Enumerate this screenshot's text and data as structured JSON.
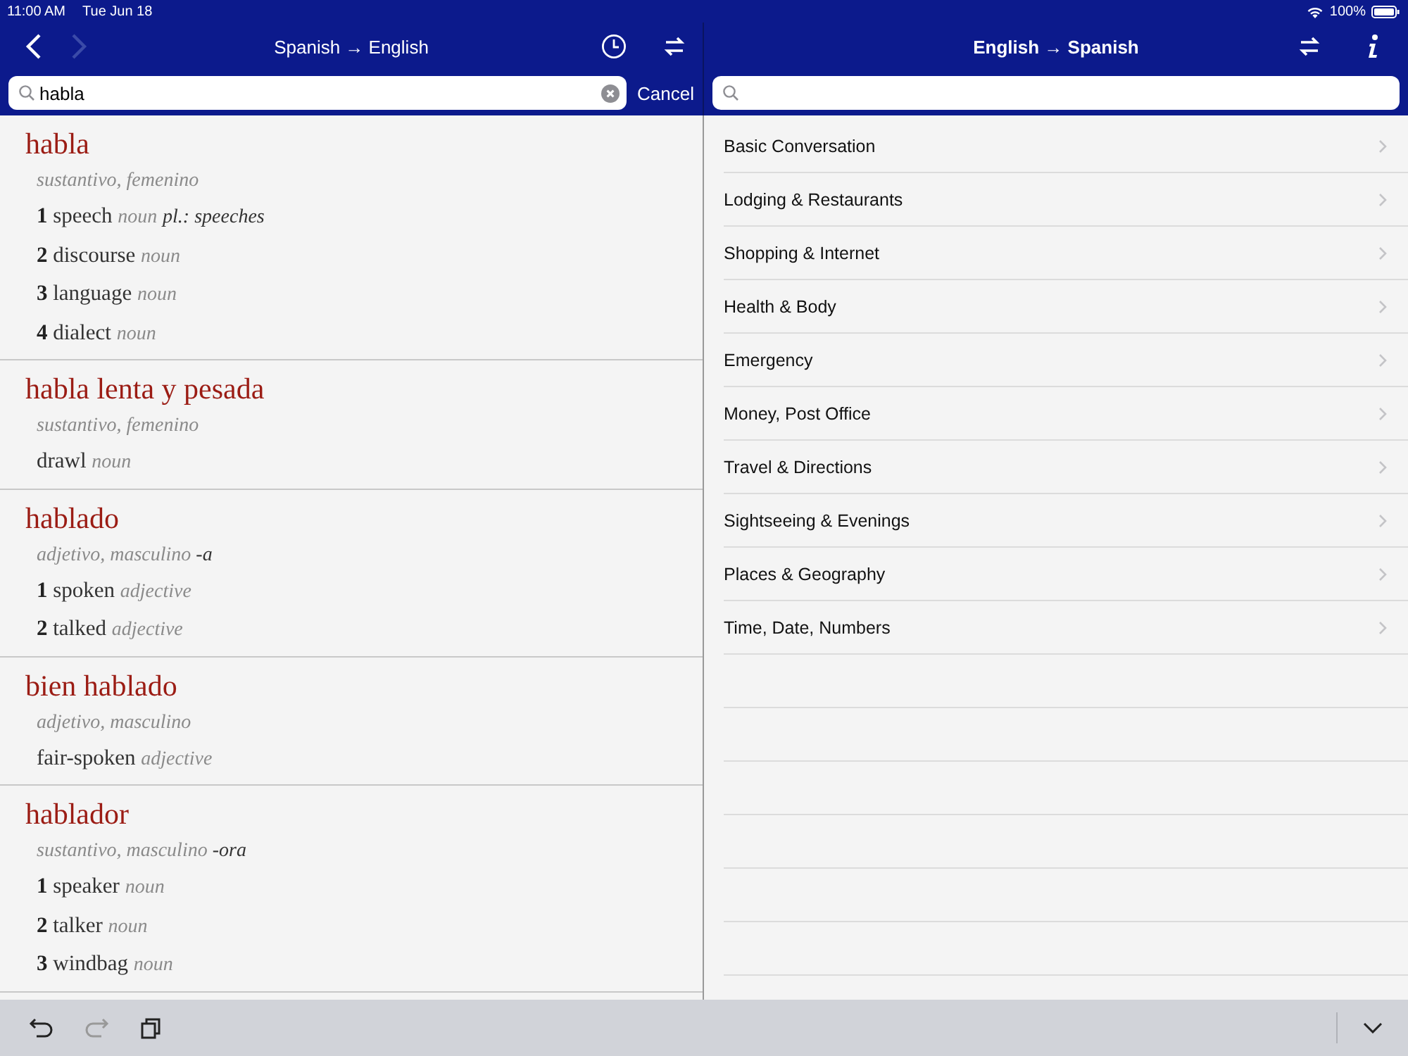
{
  "status_bar": {
    "time": "11:00 AM",
    "date": "Tue Jun 18",
    "battery": "100%"
  },
  "left_pane": {
    "nav": {
      "back": {
        "disabled": false
      },
      "forward": {
        "disabled": true
      }
    },
    "title": "Spanish → English",
    "search": {
      "value": "habla"
    },
    "cancel": "Cancel",
    "entries": [
      {
        "headword": "habla",
        "grammar": "sustantivo, femenino",
        "senses": [
          {
            "number": "1",
            "word": "speech",
            "pos": "noun",
            "extra": "pl.: speeches"
          },
          {
            "number": "2",
            "word": "discourse",
            "pos": "noun"
          },
          {
            "number": "3",
            "word": "language",
            "pos": "noun"
          },
          {
            "number": "4",
            "word": "dialect",
            "pos": "noun"
          }
        ]
      },
      {
        "headword": "habla lenta y pesada",
        "grammar": "sustantivo, femenino",
        "senses": [
          {
            "word": "drawl",
            "pos": "noun"
          }
        ]
      },
      {
        "headword": "hablado",
        "grammar": "adjetivo, masculino",
        "suffix": "-a",
        "senses": [
          {
            "number": "1",
            "word": "spoken",
            "pos": "adjective"
          },
          {
            "number": "2",
            "word": "talked",
            "pos": "adjective"
          }
        ]
      },
      {
        "headword": "bien hablado",
        "grammar": "adjetivo, masculino",
        "senses": [
          {
            "word": "fair-spoken",
            "pos": "adjective"
          }
        ]
      },
      {
        "headword": "hablador",
        "grammar": "sustantivo, masculino",
        "suffix": "-ora",
        "senses": [
          {
            "number": "1",
            "word": "speaker",
            "pos": "noun"
          },
          {
            "number": "2",
            "word": "talker",
            "pos": "noun"
          },
          {
            "number": "3",
            "word": "windbag",
            "pos": "noun"
          }
        ]
      }
    ]
  },
  "right_pane": {
    "title": "English → Spanish",
    "topics": [
      "Basic Conversation",
      "Lodging & Restaurants",
      "Shopping & Internet",
      "Health & Body",
      "Emergency",
      "Money, Post Office",
      "Travel & Directions",
      "Sightseeing & Evenings",
      "Places & Geography",
      "Time, Date, Numbers"
    ]
  },
  "toolbar": {
    "undo": {
      "disabled": false
    },
    "redo": {
      "disabled": true
    }
  }
}
